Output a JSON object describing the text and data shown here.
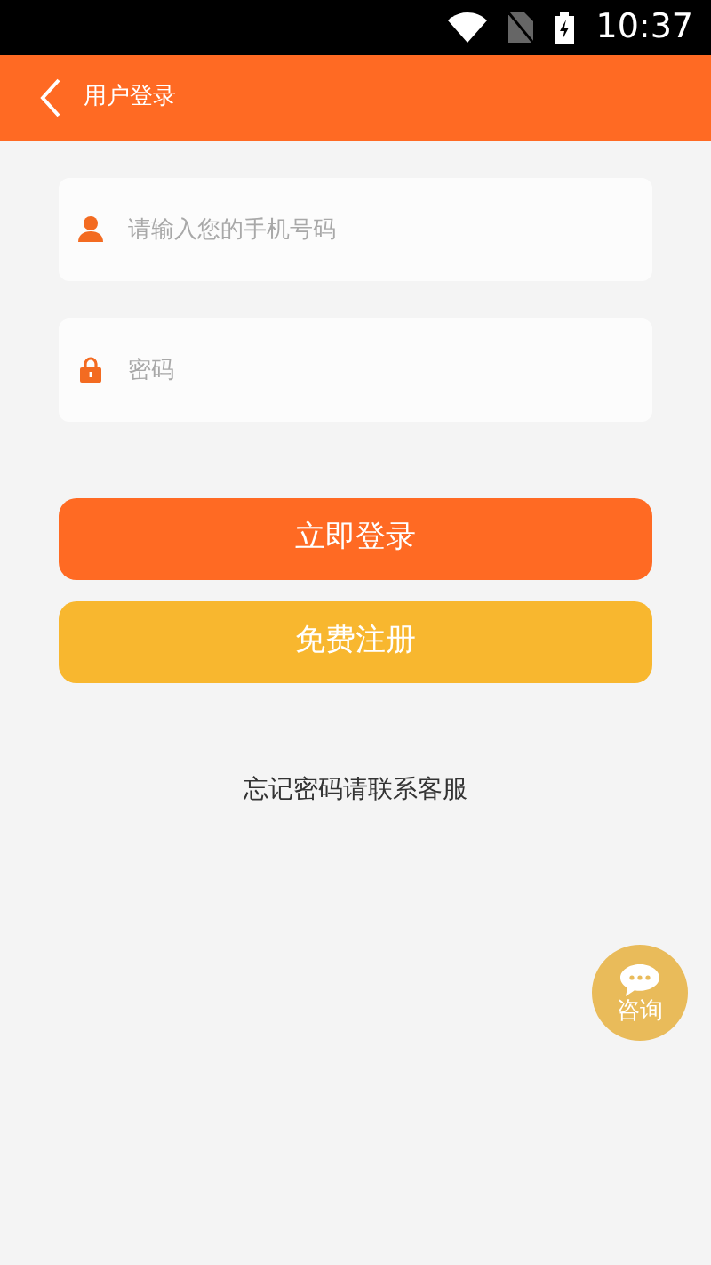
{
  "status_bar": {
    "time": "10:37"
  },
  "header": {
    "title": "用户登录"
  },
  "fields": [
    {
      "kind": "phone",
      "placeholder": "请输入您的手机号码"
    },
    {
      "kind": "password",
      "placeholder": "密码"
    }
  ],
  "buttons": [
    {
      "kind": "primary",
      "label": "立即登录"
    },
    {
      "kind": "secondary",
      "label": "免费注册"
    }
  ],
  "help_text": "忘记密码请联系客服",
  "consult_button": {
    "label": "咨询"
  }
}
